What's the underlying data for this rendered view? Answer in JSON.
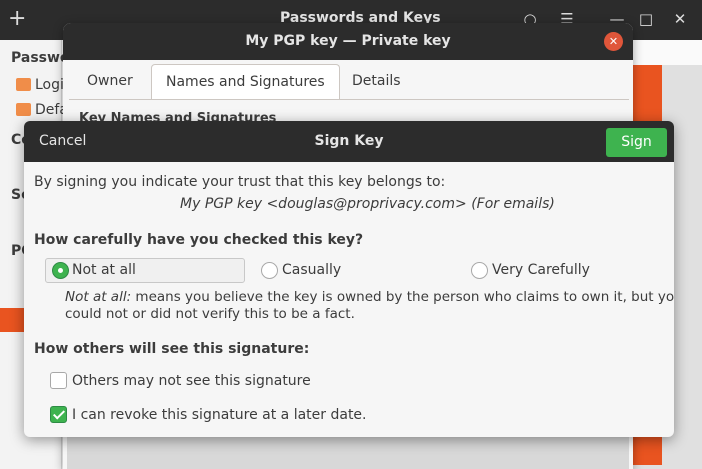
{
  "main_window": {
    "title": "Passwords and Keys",
    "sidebar": {
      "heading_1": "Passwo",
      "item_1": "Logi",
      "item_2": "Defa",
      "heading_2": "Co",
      "heading_3": "Se",
      "heading_4": "PG"
    }
  },
  "properties_window": {
    "title": "My  PGP key — Private key",
    "tabs": [
      "Owner",
      "Names and Signatures",
      "Details"
    ],
    "section_label": "Key Names and Signatures"
  },
  "sign_dialog": {
    "cancel_label": "Cancel",
    "title": "Sign Key",
    "sign_label": "Sign",
    "intro": "By signing you indicate your trust that this key belongs to:",
    "key_identity": "My  PGP key <douglas@proprivacy.com> (For emails)",
    "check_question": "How carefully have you checked this key?",
    "options": [
      {
        "label": "Not at all",
        "selected": true
      },
      {
        "label": "Casually",
        "selected": false
      },
      {
        "label": "Very Carefully",
        "selected": false
      }
    ],
    "explanation_term": "Not at all:",
    "explanation_line1": "means you believe the key is owned by the person who claims to own it, but you",
    "explanation_line2": "could not or did not verify this to be a fact.",
    "visibility_heading": "How others will see this signature:",
    "checkboxes": [
      {
        "label": "Others may not see this signature",
        "checked": false
      },
      {
        "label": "I can revoke this signature at a later date.",
        "checked": true
      }
    ]
  },
  "colors": {
    "header": "#2c2c2c",
    "sign_button": "#3eb34f",
    "close_button": "#e0563a",
    "accent": "#e95420"
  },
  "icons": [
    "add-icon",
    "search-icon",
    "menu-icon",
    "minimize-icon",
    "maximize-icon",
    "close-icon",
    "folder-icon"
  ]
}
